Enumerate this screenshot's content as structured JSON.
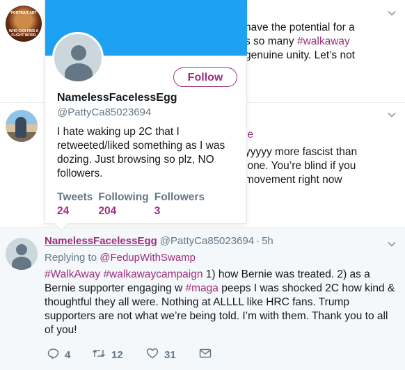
{
  "tweet1": {
    "avatar_top": "PORTRAIT ART",
    "avatar_bottom": "WHO CAN FIND A FLIGHT WORD",
    "line1": "have the potential for a",
    "line2_prefix": "s so many ",
    "line2_hashtag": "#walkaway",
    "line3": "genuine unity. Let’s not",
    "caret_icon": "chevron-down-icon"
  },
  "tweet2": {
    "line0": "le",
    "line1": "yyyyy more fascist than",
    "line2": "lone. You’re blind if you",
    "line3": "movement right now",
    "caret_icon": "chevron-down-icon"
  },
  "tweet3": {
    "name": "NamelessFacelessEgg",
    "handle": "@PattyCa85023694",
    "separator": "·",
    "time": "5h",
    "replying_prefix": "Replying to ",
    "replying_to": "@FedupWithSwamp",
    "hashtag1": "#WalkAway",
    "hashtag2": "#walkawaycampaign",
    "text1": " 1) how Bernie was treated. 2) as a Bernie supporter engaging w ",
    "hashtag3": "#maga",
    "text2": " peeps I was shocked 2C how kind & thoughtful they all were. Nothing at ALLLL like HRC fans. Trump supporters are not what we’re being told. I’m with them. Thank you to all of you!",
    "replies": "4",
    "retweets": "12",
    "likes": "31",
    "caret_icon": "chevron-down-icon"
  },
  "card": {
    "follow_label": "Follow",
    "name": "NamelessFacelessEgg",
    "handle": "@PattyCa85023694",
    "bio": "I hate waking up 2C that I retweeted/liked something as I was dozing. Just browsing so plz, NO followers.",
    "stats": [
      {
        "label": "Tweets",
        "value": "24"
      },
      {
        "label": "Following",
        "value": "204"
      },
      {
        "label": "Followers",
        "value": "3"
      }
    ]
  },
  "colors": {
    "accent": "#9b2f7e",
    "banner": "#1da1f2",
    "secondary_text": "#657786",
    "avatar_placeholder": "#ccd6dd"
  }
}
